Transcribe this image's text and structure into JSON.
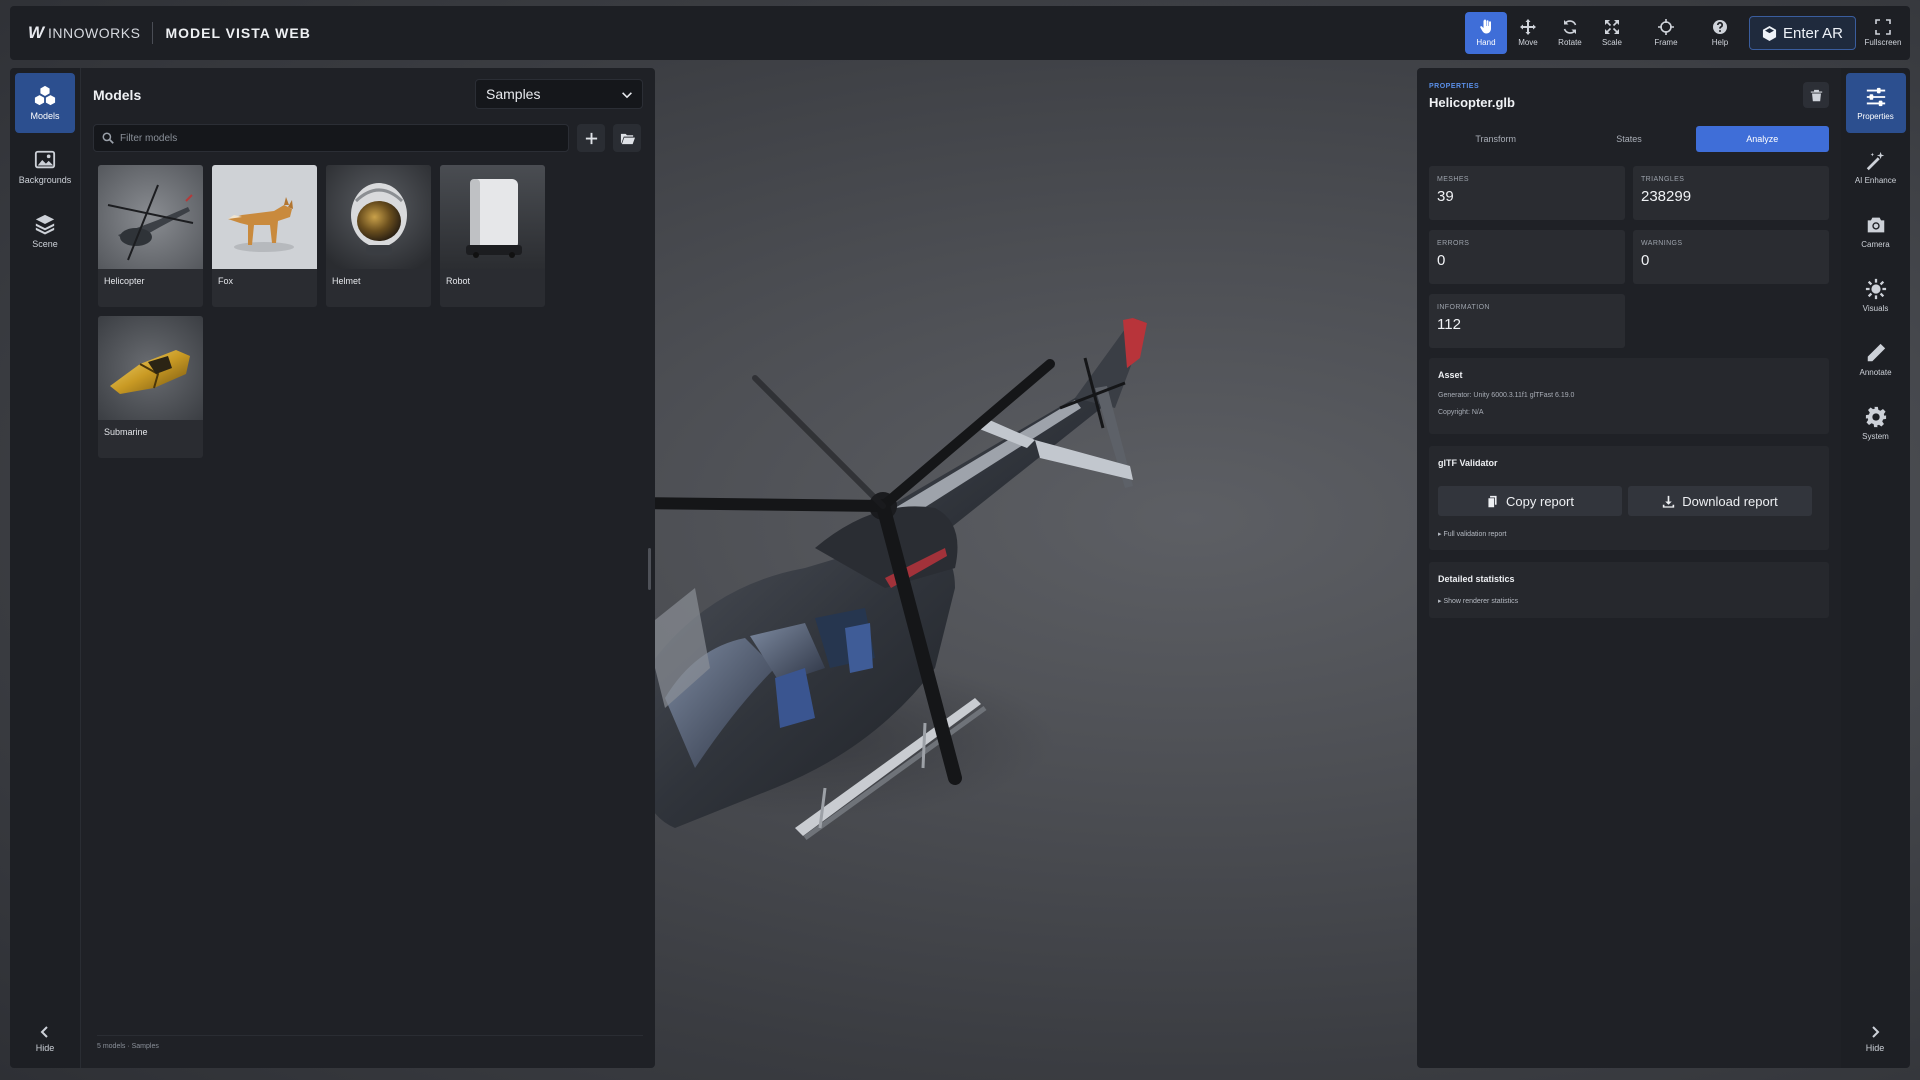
{
  "brand": {
    "logo_mark": "W",
    "logo_name": "INNOWORKS",
    "app_title": "MODEL VISTA WEB"
  },
  "toolbar": {
    "tools": [
      {
        "label": "Hand",
        "icon": "hand-icon",
        "active": true
      },
      {
        "label": "Move",
        "icon": "move-icon",
        "active": false
      },
      {
        "label": "Rotate",
        "icon": "rotate-icon",
        "active": false
      },
      {
        "label": "Scale",
        "icon": "scale-icon",
        "active": false
      },
      {
        "label": "Frame",
        "icon": "frame-icon",
        "active": false
      },
      {
        "label": "Help",
        "icon": "help-icon",
        "active": false
      }
    ],
    "enter_ar": "Enter AR",
    "fullscreen": "Fullscreen"
  },
  "left_rail": {
    "items": [
      {
        "label": "Models",
        "icon": "models-icon",
        "active": true
      },
      {
        "label": "Backgrounds",
        "icon": "image-icon",
        "active": false
      },
      {
        "label": "Scene",
        "icon": "layers-icon",
        "active": false
      }
    ],
    "hide": "Hide"
  },
  "models_panel": {
    "title": "Models",
    "collection": "Samples",
    "filter_placeholder": "Filter models",
    "filter_value": "",
    "models": [
      {
        "name": "Helicopter"
      },
      {
        "name": "Fox"
      },
      {
        "name": "Helmet"
      },
      {
        "name": "Robot"
      },
      {
        "name": "Submarine"
      }
    ],
    "footer": "5 models · Samples"
  },
  "properties": {
    "eyebrow": "PROPERTIES",
    "file_name": "Helicopter.glb",
    "tabs": [
      {
        "label": "Transform",
        "active": false
      },
      {
        "label": "States",
        "active": false
      },
      {
        "label": "Analyze",
        "active": true
      }
    ],
    "stats": {
      "meshes_label": "MESHES",
      "meshes": "39",
      "triangles_label": "TRIANGLES",
      "triangles": "238299",
      "errors_label": "ERRORS",
      "errors": "0",
      "warnings_label": "WARNINGS",
      "warnings": "0",
      "information_label": "INFORMATION",
      "information": "112"
    },
    "asset": {
      "title": "Asset",
      "generator": "Generator: Unity 6000.3.11f1 glTFast 6.19.0",
      "copyright": "Copyright: N/A"
    },
    "validator": {
      "title": "glTF Validator",
      "copy_report": "Copy report",
      "download_report": "Download report",
      "full_report": "▸ Full validation report"
    },
    "detailed": {
      "title": "Detailed statistics",
      "show_renderer": "▸ Show renderer statistics"
    }
  },
  "right_rail": {
    "items": [
      {
        "label": "Properties",
        "icon": "sliders-icon",
        "active": true
      },
      {
        "label": "AI Enhance",
        "icon": "magic-wand-icon",
        "active": false
      },
      {
        "label": "Camera",
        "icon": "camera-icon",
        "active": false
      },
      {
        "label": "Visuals",
        "icon": "sun-icon",
        "active": false
      },
      {
        "label": "Annotate",
        "icon": "pencil-icon",
        "active": false
      },
      {
        "label": "System",
        "icon": "gear-icon",
        "active": false
      }
    ],
    "hide": "Hide"
  },
  "colors": {
    "accent": "#3f6ed8",
    "panel": "#1f2126",
    "rail": "#1d1f24",
    "card": "#2a2c31"
  }
}
